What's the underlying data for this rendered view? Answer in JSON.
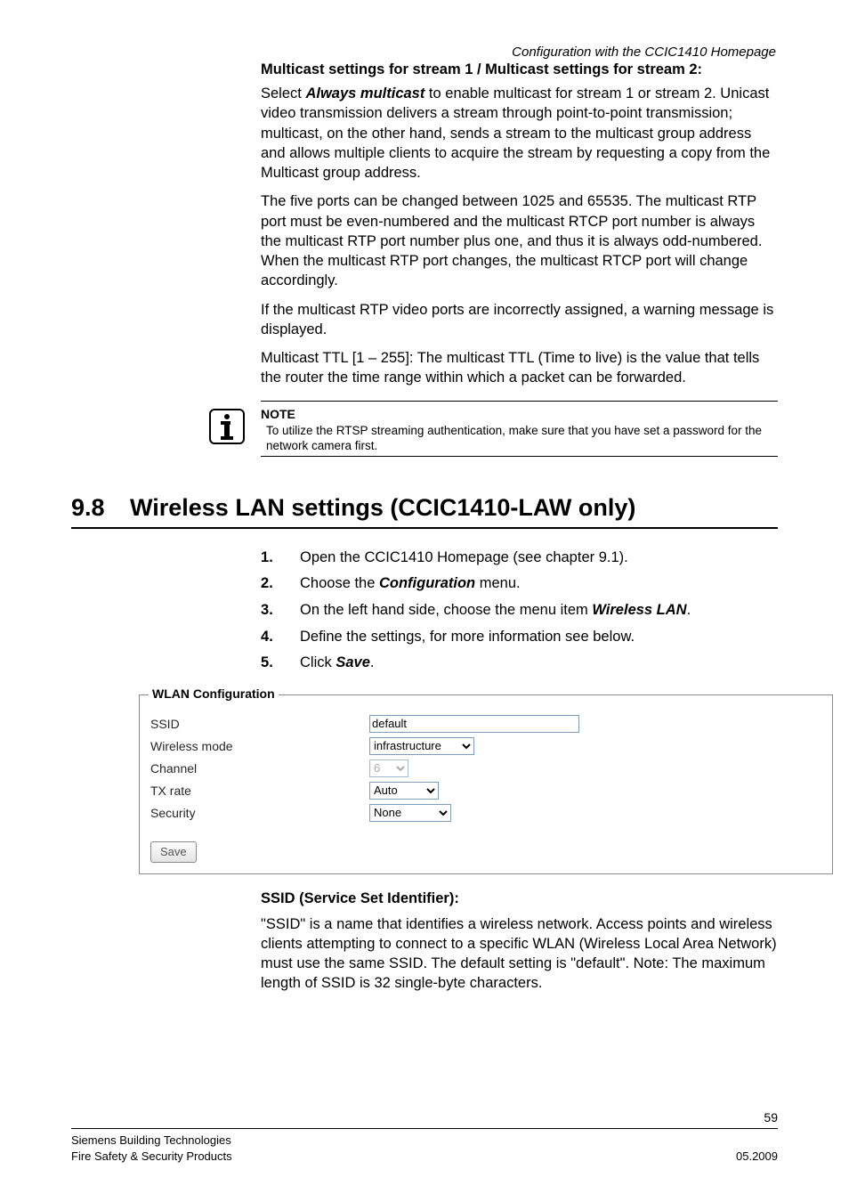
{
  "header": {
    "right_italic": "Configuration with the CCIC1410 Homepage"
  },
  "multicast": {
    "subhead": "Multicast settings for stream 1 / Multicast settings for stream 2:",
    "p1_a": "Select ",
    "p1_b": "Always multicast",
    "p1_c": " to enable multicast for stream 1 or stream 2. Unicast video transmission delivers a stream through point-to-point transmission; multicast, on the other hand, sends a stream to the multicast group address and allows multiple clients to acquire the stream by requesting a copy from the Multicast group address.",
    "p2": "The five ports can be changed between 1025 and 65535. The multicast RTP port must be even-numbered and the multicast RTCP port number is always the multicast RTP port number plus one, and thus it is always odd-numbered. When the multicast RTP port changes, the multicast RTCP port will change accordingly.",
    "p3": "If the multicast RTP video ports are incorrectly assigned, a warning message is displayed.",
    "p4": "Multicast TTL [1 – 255]: The multicast TTL (Time to live) is the value that tells the router the time range within which a packet can be forwarded."
  },
  "note": {
    "title": "NOTE",
    "text": "To utilize the RTSP streaming authentication, make sure that you have set a password for the network camera first."
  },
  "section": {
    "num": "9.8",
    "title": "Wireless LAN settings (CCIC1410-LAW only)",
    "step1_a": "Open the CCIC1410 Homepage (see chapter 9.1).",
    "step2_a": "Choose the ",
    "step2_b": "Configuration",
    "step2_c": " menu.",
    "step3_a": "On the left hand side, choose the menu item ",
    "step3_b": "Wireless LAN",
    "step3_c": ".",
    "step4_a": "Define the settings, for more information see below.",
    "step5_a": "Click ",
    "step5_b": "Save",
    "step5_c": "."
  },
  "wlan": {
    "legend": "WLAN Configuration",
    "labels": {
      "ssid": "SSID",
      "mode": "Wireless mode",
      "channel": "Channel",
      "tx": "TX rate",
      "sec": "Security"
    },
    "values": {
      "ssid": "default",
      "mode": "infrastructure",
      "channel": "6",
      "tx": "Auto",
      "sec": "None"
    },
    "save": "Save"
  },
  "ssid_section": {
    "subhead": "SSID (Service Set Identifier):",
    "para": "\"SSID\" is a name that identifies a wireless network. Access points and wireless clients attempting to connect to a specific WLAN (Wireless Local Area Network) must use the same SSID. The default setting is \"default\". Note: The maximum length of SSID is 32 single-byte characters."
  },
  "footer": {
    "pagenum": "59",
    "left1": "Siemens Building Technologies",
    "left2": "Fire Safety & Security Products",
    "right2": "05.2009"
  }
}
